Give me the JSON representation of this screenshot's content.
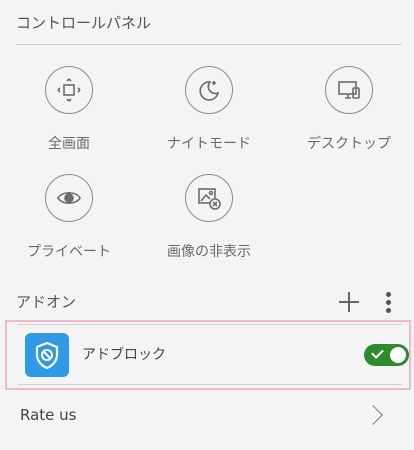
{
  "control_panel": {
    "title": "コントロールパネル",
    "tiles": [
      {
        "label": "全画面",
        "icon": "fullscreen-icon"
      },
      {
        "label": "ナイトモード",
        "icon": "night-mode-icon"
      },
      {
        "label": "デスクトップ",
        "icon": "desktop-icon"
      },
      {
        "label": "プライベート",
        "icon": "private-eye-icon"
      },
      {
        "label": "画像の非表示",
        "icon": "hide-images-icon"
      }
    ]
  },
  "addons": {
    "title": "アドオン",
    "items": [
      {
        "label": "アドブロック",
        "icon": "adblock-shield-icon",
        "enabled": true
      }
    ]
  },
  "rate": {
    "label": "Rate us"
  },
  "colors": {
    "toggle_on": "#2e8a2c",
    "adblock_icon_bg": "#2f9be6",
    "highlight_border": "#f1b8cd"
  }
}
